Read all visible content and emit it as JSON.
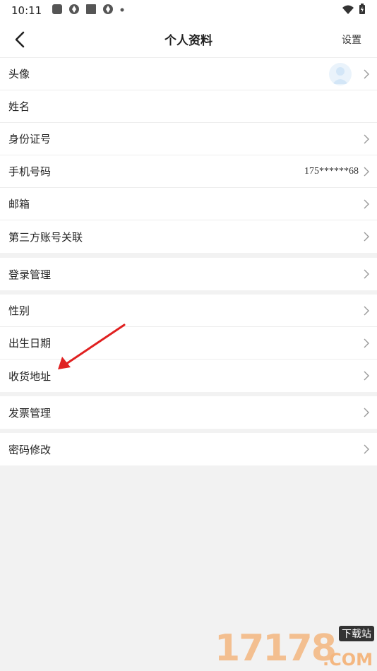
{
  "status_bar": {
    "time": "10:11"
  },
  "header": {
    "title": "个人资料",
    "settings_label": "设置"
  },
  "groups": [
    {
      "rows": [
        {
          "label": "头像",
          "value": ""
        },
        {
          "label": "姓名",
          "value": ""
        },
        {
          "label": "身份证号",
          "value": ""
        },
        {
          "label": "手机号码",
          "value": "175******68"
        },
        {
          "label": "邮箱",
          "value": ""
        },
        {
          "label": "第三方账号关联",
          "value": ""
        }
      ]
    },
    {
      "rows": [
        {
          "label": "登录管理",
          "value": ""
        }
      ]
    },
    {
      "rows": [
        {
          "label": "性别",
          "value": ""
        },
        {
          "label": "出生日期",
          "value": ""
        },
        {
          "label": "收货地址",
          "value": ""
        }
      ]
    },
    {
      "rows": [
        {
          "label": "发票管理",
          "value": ""
        }
      ]
    },
    {
      "rows": [
        {
          "label": "密码修改",
          "value": ""
        }
      ]
    }
  ],
  "watermark": {
    "digits": "17178",
    "badge": "下载站",
    "suffix": ".COM"
  },
  "colors": {
    "background": "#f2f2f2",
    "annotation_arrow": "#e02020",
    "watermark": "#f4b780"
  }
}
